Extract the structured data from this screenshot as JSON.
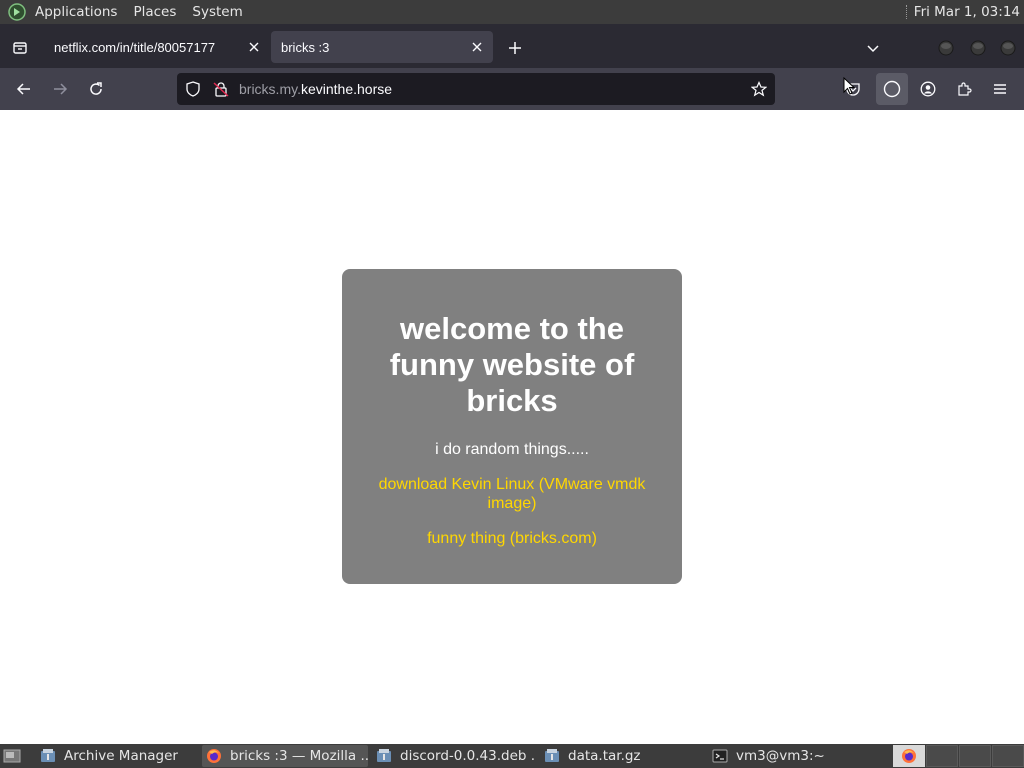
{
  "system_panel": {
    "menus": [
      "Applications",
      "Places",
      "System"
    ],
    "clock": "Fri Mar  1, 03:14"
  },
  "browser": {
    "tabs": [
      {
        "label": "netflix.com/in/title/80057177",
        "active": false
      },
      {
        "label": "bricks :3",
        "active": true
      }
    ],
    "url": {
      "subdomain": "bricks.my.",
      "host": "kevinthe.horse"
    }
  },
  "page": {
    "heading": "welcome to the funny website of bricks",
    "tagline": "i do random things.....",
    "links": [
      "download Kevin Linux (VMware vmdk image)",
      "funny thing (bricks.com)"
    ],
    "colors": {
      "card_bg": "#808080",
      "link": "#ffd700",
      "heading": "#ffffff"
    }
  },
  "taskbar": {
    "items": [
      {
        "label": "Archive Manager",
        "icon": "archive-manager-icon"
      },
      {
        "label": "bricks :3 — Mozilla ...",
        "icon": "firefox-icon",
        "active": true
      },
      {
        "label": "discord-0.0.43.deb ...",
        "icon": "archive-manager-icon"
      },
      {
        "label": "data.tar.gz",
        "icon": "archive-manager-icon"
      },
      {
        "label": "vm3@vm3:~",
        "icon": "terminal-icon"
      }
    ]
  }
}
